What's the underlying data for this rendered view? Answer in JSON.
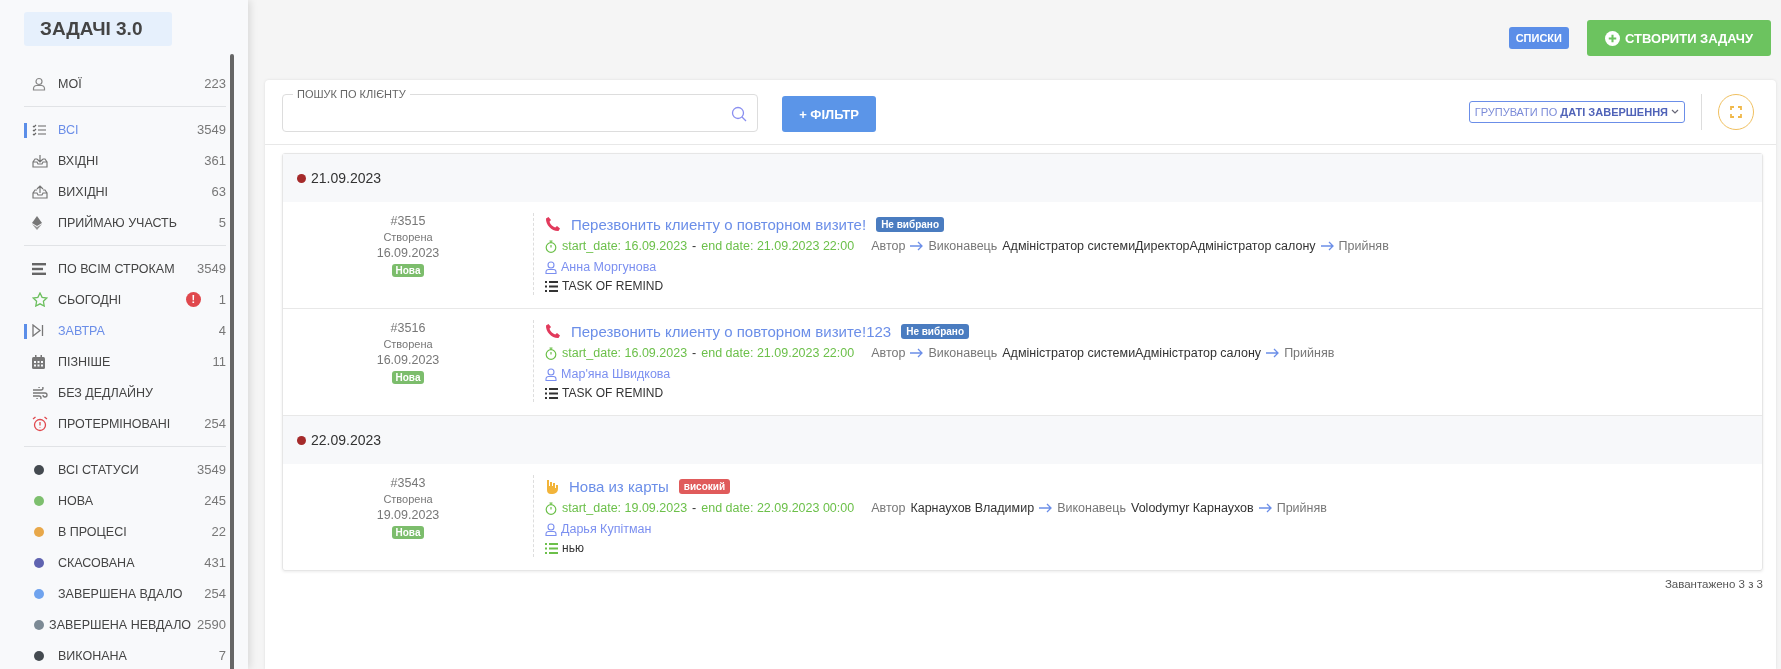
{
  "app_title": "ЗАДАЧІ 3.0",
  "sidebar": {
    "sections": [
      {
        "items": [
          {
            "kind": "user",
            "label": "МОЇ",
            "count": "223",
            "selected": false
          }
        ]
      },
      {
        "items": [
          {
            "kind": "checklist",
            "label": "ВСІ",
            "count": "3549",
            "selected": true
          },
          {
            "kind": "inbox",
            "label": "ВХІДНІ",
            "count": "361",
            "selected": false
          },
          {
            "kind": "outbox",
            "label": "ВИХІДНІ",
            "count": "63",
            "selected": false
          },
          {
            "kind": "diamond",
            "label": "ПРИЙМАЮ УЧАСТЬ",
            "count": "5",
            "selected": false
          }
        ]
      },
      {
        "items": [
          {
            "kind": "bars",
            "label": "ПО ВСІМ СТРОКАМ",
            "count": "3549",
            "selected": false
          },
          {
            "kind": "star",
            "label": "СЬОГОДНІ",
            "alert": "!",
            "count": "1",
            "selected": false
          },
          {
            "kind": "skip",
            "label": "ЗАВТРА",
            "count": "4",
            "selected": true
          },
          {
            "kind": "calendar",
            "label": "ПІЗНІШЕ",
            "count": "11",
            "selected": false
          },
          {
            "kind": "wind",
            "label": "БЕЗ ДЕДЛАЙНУ",
            "selected": false
          },
          {
            "kind": "alarm",
            "label": "ПРОТЕРМІНОВАНІ",
            "count": "254",
            "selected": false
          }
        ]
      },
      {
        "items": [
          {
            "kind": "dot",
            "color": "#444a50",
            "label": "ВСІ СТАТУСИ",
            "count": "3549",
            "selected": false
          },
          {
            "kind": "dot",
            "color": "#7dbf6e",
            "label": "НОВА",
            "count": "245",
            "selected": false
          },
          {
            "kind": "dot",
            "color": "#e8a84a",
            "label": "В ПРОЦЕСІ",
            "count": "22",
            "selected": false
          },
          {
            "kind": "dot",
            "color": "#5f63b0",
            "label": "СКАСОВАНА",
            "count": "431",
            "selected": false
          },
          {
            "kind": "dot",
            "color": "#6fa3ee",
            "label": "ЗАВЕРШЕНА ВДАЛО",
            "count": "254",
            "selected": false
          },
          {
            "kind": "dot",
            "color": "#7c8a95",
            "label": "ЗАВЕРШЕНА НЕВДАЛО",
            "count": "2590",
            "selected": false
          },
          {
            "kind": "dot",
            "color": "#444a50",
            "label": "ВИКОНАНА",
            "count": "7",
            "selected": false
          }
        ]
      }
    ]
  },
  "top_buttons": {
    "lists": "СПИСКИ",
    "create": "СТВОРИТИ ЗАДАЧУ"
  },
  "toolbar": {
    "search_label": "ПОШУК ПО КЛІЄНТУ",
    "filter": "+ ФІЛЬТР",
    "group_by_prefix": "ГРУПУВАТИ ПО",
    "group_by_value": "ДАТІ ЗАВЕРШЕННЯ"
  },
  "groups": [
    {
      "date": "21.09.2023",
      "tasks": [
        {
          "number": "#3515",
          "created_label": "Створена",
          "created_date": "16.09.2023",
          "status": "Нова",
          "kind": "phone",
          "title": "Перезвонить клиенту о повторном визите!",
          "badge": {
            "kind": "neutral",
            "text": "Не вибрано"
          },
          "start": "start_date: 16.09.2023",
          "sep": "-",
          "end": "end date: 21.09.2023 22:00",
          "author_label": "Автор",
          "executor_label": "Виконавець",
          "executor": "Адміністратор системиДиректорАдміністратор салону",
          "accepted": "Прийняв",
          "client": "Анна Моргунова",
          "category": {
            "text": "TASK OF REMIND",
            "color": "#333333"
          }
        },
        {
          "number": "#3516",
          "created_label": "Створена",
          "created_date": "16.09.2023",
          "status": "Нова",
          "kind": "phone",
          "title": "Перезвонить клиенту о повторном визите!123",
          "badge": {
            "kind": "neutral",
            "text": "Не вибрано"
          },
          "start": "start_date: 16.09.2023",
          "sep": "-",
          "end": "end date: 21.09.2023 22:00",
          "author_label": "Автор",
          "executor_label": "Виконавець",
          "executor": "Адміністратор системиАдміністратор салону",
          "accepted": "Прийняв",
          "client": "Мар'яна Швидкова",
          "category": {
            "text": "TASK OF REMIND",
            "color": "#333333"
          }
        }
      ]
    },
    {
      "date": "22.09.2023",
      "tasks": [
        {
          "number": "#3543",
          "created_label": "Створена",
          "created_date": "19.09.2023",
          "status": "Нова",
          "kind": "hand",
          "title": "Нова из карты",
          "badge": {
            "kind": "high",
            "text": "високий"
          },
          "start": "start_date: 19.09.2023",
          "sep": "-",
          "end": "end date: 22.09.2023 00:00",
          "author_label": "Автор",
          "author": "Карнаухов Владимир",
          "executor_label": "Виконавець",
          "executor": "Volodymyr Карнаухов",
          "accepted": "Прийняв",
          "client": "Дарья Купітман",
          "category": {
            "text": "нью",
            "color": "#6cc04a"
          }
        }
      ]
    }
  ],
  "loaded": "Завантажено 3 з 3"
}
